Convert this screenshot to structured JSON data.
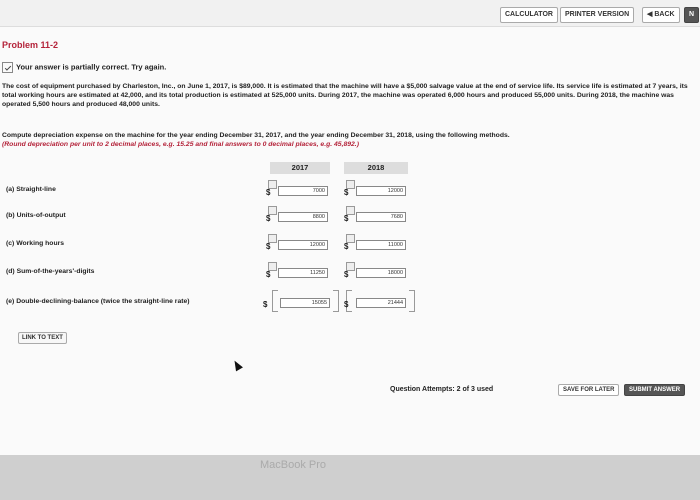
{
  "topbar": {
    "calculator": "CALCULATOR",
    "printer_version": "PRINTER VERSION",
    "back": "◀ BACK",
    "next": "N"
  },
  "problem": {
    "title": "Problem 11-2",
    "notice": "Your answer is partially correct.  Try again.",
    "paragraph": "The cost of equipment purchased by Charleston, Inc., on June 1, 2017, is $89,000. It is estimated that the machine will have a $5,000 salvage value at the end of service life. Its service life is estimated at 7 years, its total working hours are estimated at 42,000, and its total production is estimated at 525,000 units. During 2017, the machine was operated 6,000 hours and produced 55,000 units. During 2018, the machine was operated 5,500 hours and produced 48,000 units.",
    "instruction": "Compute depreciation expense on the machine for the year ending December 31, 2017, and the year ending December 31, 2018, using the following methods.",
    "hint": "(Round depreciation per unit to 2 decimal places, e.g. 15.25 and final answers to 0 decimal places, e.g. 45,892.)"
  },
  "table": {
    "col_2017": "2017",
    "col_2018": "2018",
    "rows": [
      {
        "label": "(a)  Straight-line",
        "v2017": "7000",
        "v2018": "12000"
      },
      {
        "label": "(b)  Units-of-output",
        "v2017": "8800",
        "v2018": "7680"
      },
      {
        "label": "(c)  Working hours",
        "v2017": "12000",
        "v2018": "11000"
      },
      {
        "label": "(d)  Sum-of-the-years'-digits",
        "v2017": "11250",
        "v2018": "18000"
      },
      {
        "label": "(e)  Double-declining-balance (twice the straight-line rate)",
        "v2017": "15055",
        "v2018": "21444"
      }
    ]
  },
  "footer": {
    "link_to_text": "LINK TO TEXT",
    "attempts": "Question Attempts: 2 of 3 used",
    "save_later": "SAVE FOR LATER",
    "submit": "SUBMIT ANSWER"
  },
  "bezel": {
    "label": "MacBook Pro"
  }
}
